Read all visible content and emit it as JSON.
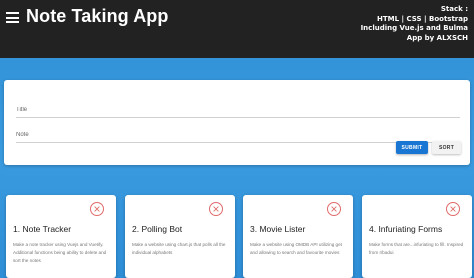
{
  "header": {
    "title": "Note Taking App",
    "stack": {
      "line1": "Stack :",
      "line2": "HTML | CSS | Bootstrap",
      "line3": "Including Vue.js and Bulma",
      "line4": "App by ALXSCH"
    },
    "background_color": "#222222"
  },
  "form": {
    "title_placeholder": "Title",
    "note_placeholder": "Note",
    "submit_label": "SUBMIT",
    "sort_label": "SORT",
    "submit_color": "#1976d2"
  },
  "notes": [
    {
      "title": "1. Note Tracker",
      "body": "Make a note tracker using Vuejs and Vuetify. Additional functions being ability to delete and sort the notes"
    },
    {
      "title": "2. Polling Bot",
      "body": "Make a website using chart.js that polls all the individual alphabets"
    },
    {
      "title": "3. Movie Lister",
      "body": "Make a website using OMDB API utilizing get and allowing to search and favourite movies"
    },
    {
      "title": "4. Infuriating Forms",
      "body": "Make forms that are...infuriating to fill. Inspired from r/badui"
    }
  ],
  "icons": {
    "menu": "menu-icon",
    "delete": "close-icon"
  },
  "colors": {
    "page_background": "#3a9be0",
    "delete_icon": "#e06a6a"
  }
}
